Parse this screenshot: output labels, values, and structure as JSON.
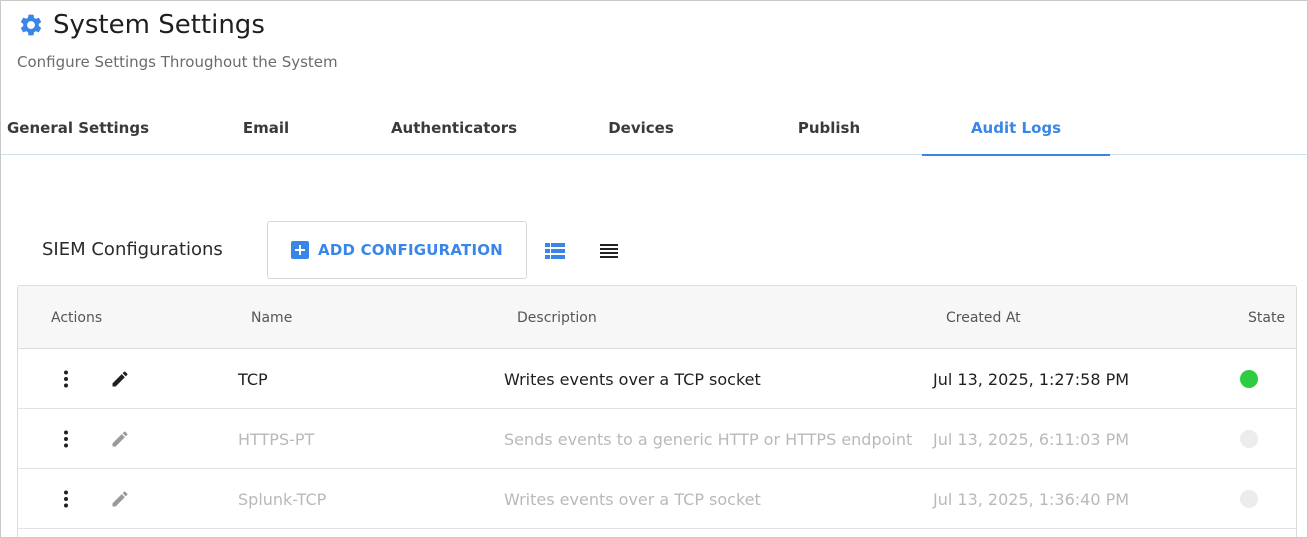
{
  "header": {
    "title": "System Settings",
    "subtitle": "Configure Settings Throughout the System",
    "icon": "gear-icon",
    "accent_color": "#3a86e8"
  },
  "tabs": [
    {
      "label": "General Settings",
      "active": false
    },
    {
      "label": "Email",
      "active": false
    },
    {
      "label": "Authenticators",
      "active": false
    },
    {
      "label": "Devices",
      "active": false
    },
    {
      "label": "Publish",
      "active": false
    },
    {
      "label": "Audit Logs",
      "active": true
    }
  ],
  "toolbar": {
    "section_label": "SIEM Configurations",
    "add_label": "ADD CONFIGURATION",
    "view_icons": [
      "list-detailed-icon",
      "list-compact-icon"
    ]
  },
  "table": {
    "columns": [
      "Actions",
      "Name",
      "Description",
      "Created At",
      "State"
    ],
    "rows": [
      {
        "name": "TCP",
        "description": "Writes events over a TCP socket",
        "created_at": "Jul 13, 2025, 1:27:58 PM",
        "enabled": true,
        "state_color": "#2ecc40"
      },
      {
        "name": "HTTPS-PT",
        "description": "Sends events to a generic HTTP or HTTPS endpoint",
        "created_at": "Jul 13, 2025, 6:11:03 PM",
        "enabled": false,
        "state_color": "#ececec"
      },
      {
        "name": "Splunk-TCP",
        "description": "Writes events over a TCP socket",
        "created_at": "Jul 13, 2025, 1:36:40 PM",
        "enabled": false,
        "state_color": "#ececec"
      }
    ]
  }
}
